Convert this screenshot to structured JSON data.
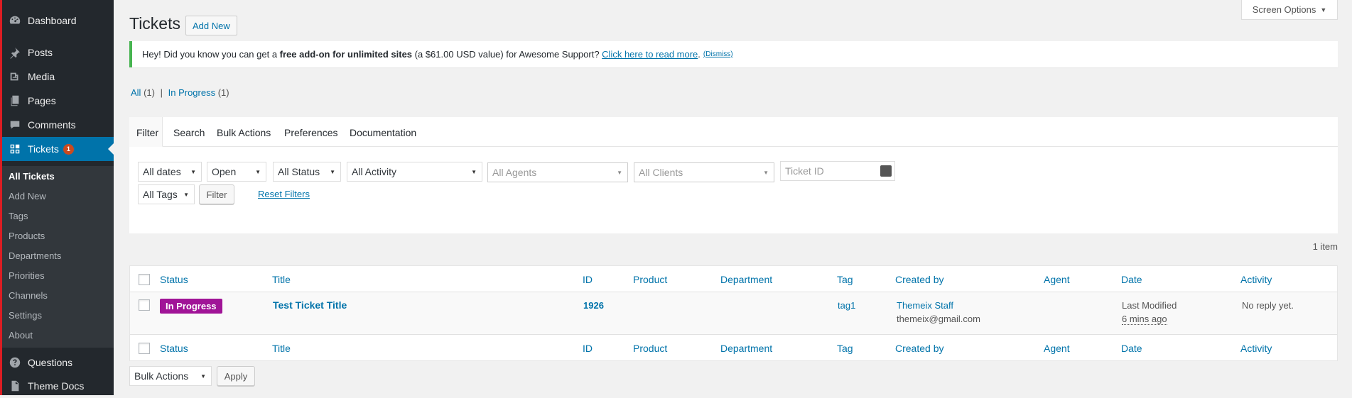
{
  "sidebar": {
    "dashboard": "Dashboard",
    "posts": "Posts",
    "media": "Media",
    "pages": "Pages",
    "comments": "Comments",
    "tickets": "Tickets",
    "tickets_badge": "1",
    "submenu": [
      "All Tickets",
      "Add New",
      "Tags",
      "Products",
      "Departments",
      "Priorities",
      "Channels",
      "Settings",
      "About"
    ],
    "questions": "Questions",
    "theme_docs": "Theme Docs"
  },
  "header": {
    "screen_options": "Screen Options",
    "title": "Tickets",
    "add_new": "Add New"
  },
  "notice": {
    "prefix": "Hey! Did you know you can get a ",
    "bold": "free add-on for unlimited sites",
    "middle": " (a $61.00 USD value) for Awesome Support? ",
    "link": "Click here to read more",
    "period": ".",
    "dismiss": "(Dismiss)"
  },
  "views": {
    "all": "All",
    "all_count": "(1)",
    "in_progress": "In Progress",
    "in_progress_count": "(1)"
  },
  "tabs": [
    "Filter",
    "Search",
    "Bulk Actions",
    "Preferences",
    "Documentation"
  ],
  "filters": {
    "dates": "All dates",
    "state": "Open",
    "status": "All Status",
    "activity": "All Activity",
    "agents": "All Agents",
    "clients": "All Clients",
    "ticket_id_placeholder": "Ticket ID",
    "tags": "All Tags",
    "filter_button": "Filter",
    "reset": "Reset Filters"
  },
  "items_count": "1 item",
  "table": {
    "columns": [
      "Status",
      "Title",
      "ID",
      "Product",
      "Department",
      "Tag",
      "Created by",
      "Agent",
      "Date",
      "Activity"
    ],
    "rows": [
      {
        "status": "In Progress",
        "title": "Test Ticket Title",
        "id": "1926",
        "product": "",
        "department": "",
        "tag": "tag1",
        "created_by_name": "Themeix Staff",
        "created_by_email": "themeix@gmail.com",
        "agent": "",
        "date_label": "Last Modified",
        "date_value": "6 mins ago",
        "activity": "No reply yet."
      }
    ]
  },
  "bottom": {
    "bulk_actions": "Bulk Actions",
    "apply": "Apply"
  },
  "colors": {
    "sidebar_bg": "#23282d",
    "accent_red": "#dc1d23",
    "active_blue": "#0073aa",
    "notice_green": "#46b450",
    "status_purple": "#a01497"
  }
}
